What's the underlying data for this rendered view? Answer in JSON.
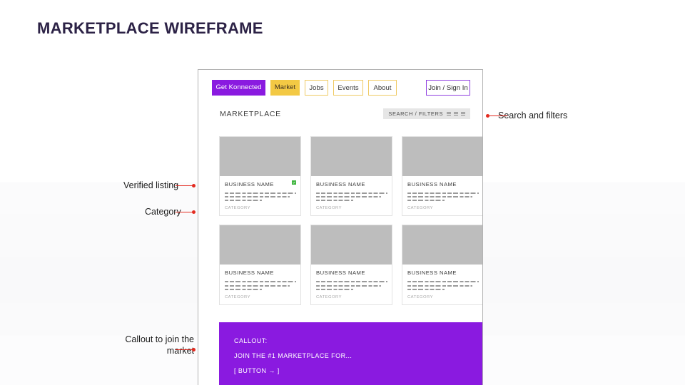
{
  "slide": {
    "title": "MARKETPLACE WIREFRAME",
    "title_color": "#2c2246"
  },
  "colors": {
    "brand_purple": "#8a1ae0",
    "brand_gold": "#f3c944",
    "annotation_red": "#e32b20",
    "verified_green": "#3fb53f",
    "thumb_gray": "#bdbdbd"
  },
  "mock": {
    "nav": {
      "primary_label": "Get Konnected",
      "items": [
        {
          "label": "Market",
          "state": "active"
        },
        {
          "label": "Jobs",
          "state": "outline"
        },
        {
          "label": "Events",
          "state": "outline"
        },
        {
          "label": "About",
          "state": "outline"
        }
      ],
      "join_label": "Join / Sign In"
    },
    "page": {
      "heading": "MARKETPLACE",
      "filter_label": "SEARCH / FILTERS",
      "filter_icon": "filter-bars-icon"
    },
    "cards": [
      {
        "title": "BUSINESS NAME",
        "category": "CATEGORY",
        "verified": true,
        "verified_icon": "verified-check-icon"
      },
      {
        "title": "BUSINESS NAME",
        "category": "CATEGORY",
        "verified": false
      },
      {
        "title": "BUSINESS NAME",
        "category": "CATEGORY",
        "verified": false
      },
      {
        "title": "BUSINESS NAME",
        "category": "CATEGORY",
        "verified": false
      },
      {
        "title": "BUSINESS NAME",
        "category": "CATEGORY",
        "verified": false
      },
      {
        "title": "BUSINESS NAME",
        "category": "CATEGORY",
        "verified": false
      }
    ],
    "callout": {
      "line1": "CALLOUT:",
      "line2": "JOIN THE #1 MARKETPLACE FOR...",
      "line3": "[ BUTTON → ]"
    }
  },
  "annotations": {
    "verified": "Verified listing",
    "category": "Category",
    "callout": "Callout to join the\nmarket",
    "search": "Search and filters"
  }
}
